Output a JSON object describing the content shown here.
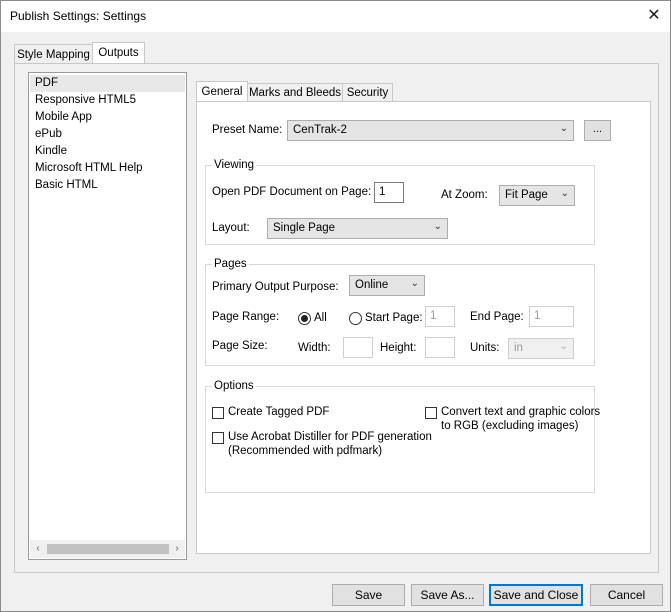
{
  "window": {
    "title": "Publish Settings: Settings",
    "close_glyph": "✕"
  },
  "outer_tabs": [
    "Style Mapping",
    "Outputs"
  ],
  "outputs_list": {
    "items": [
      "PDF",
      "Responsive HTML5",
      "Mobile App",
      "ePub",
      "Kindle",
      "Microsoft HTML Help",
      "Basic HTML"
    ],
    "selected": "PDF",
    "scroll_left": "‹",
    "scroll_right": "›"
  },
  "inner_tabs": [
    "General",
    "Marks and Bleeds",
    "Security"
  ],
  "general": {
    "preset_label": "Preset Name:",
    "preset_value": "CenTrak-2",
    "preset_browse": "...",
    "viewing": {
      "title": "Viewing",
      "open_page_label": "Open PDF Document on Page:",
      "open_page_value": "1",
      "zoom_label": "At Zoom:",
      "zoom_value": "Fit Page",
      "layout_label": "Layout:",
      "layout_value": "Single Page"
    },
    "pages": {
      "title": "Pages",
      "purpose_label": "Primary Output Purpose:",
      "purpose_value": "Online",
      "range_label": "Page Range:",
      "range_all": "All",
      "range_start": "Start Page:",
      "start_value": "1",
      "end_label": "End Page:",
      "end_value": "1",
      "size_label": "Page Size:",
      "width_label": "Width:",
      "height_label": "Height:",
      "units_label": "Units:",
      "units_value": "in"
    },
    "options": {
      "title": "Options",
      "tagged_pdf": "Create Tagged PDF",
      "distiller_line1": "Use Acrobat Distiller for PDF generation",
      "distiller_line2": "(Recommended with pdfmark)",
      "convert_line1": "Convert text and graphic colors",
      "convert_line2": "to RGB (excluding images)"
    }
  },
  "footer": {
    "save": "Save",
    "save_as": "Save As...",
    "save_close": "Save and Close",
    "cancel": "Cancel"
  },
  "dropdown_glyph": "⌄"
}
